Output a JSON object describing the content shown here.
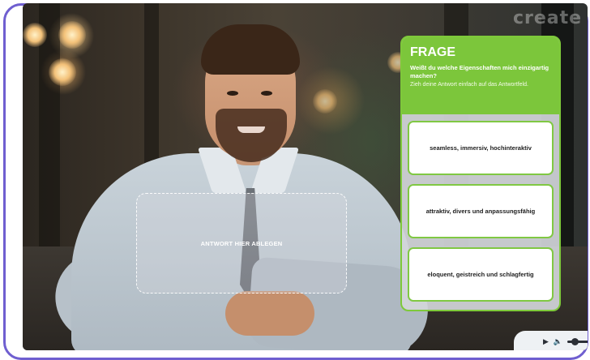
{
  "watermark": "create",
  "dropzone": {
    "label": "ANTWORT HIER ABLEGEN"
  },
  "question_panel": {
    "title": "FRAGE",
    "question": "Weißt du welche Eigenschaften mich einzigartig machen?",
    "hint": "Zieh deine Antwort einfach auf das Antwortfeld."
  },
  "answers": [
    {
      "label": "seamless, immersiv, hochinteraktiv"
    },
    {
      "label": "attraktiv, divers und anpassungsfähig"
    },
    {
      "label": "eloquent, geistreich und schlagfertig"
    }
  ],
  "player": {
    "play_icon": "play-icon",
    "volume_icon": "volume-icon",
    "volume_level_percent": 25
  },
  "colors": {
    "frame_border": "#6f5fd0",
    "accent_green": "#7cc63b",
    "answer_border": "#80c843"
  }
}
